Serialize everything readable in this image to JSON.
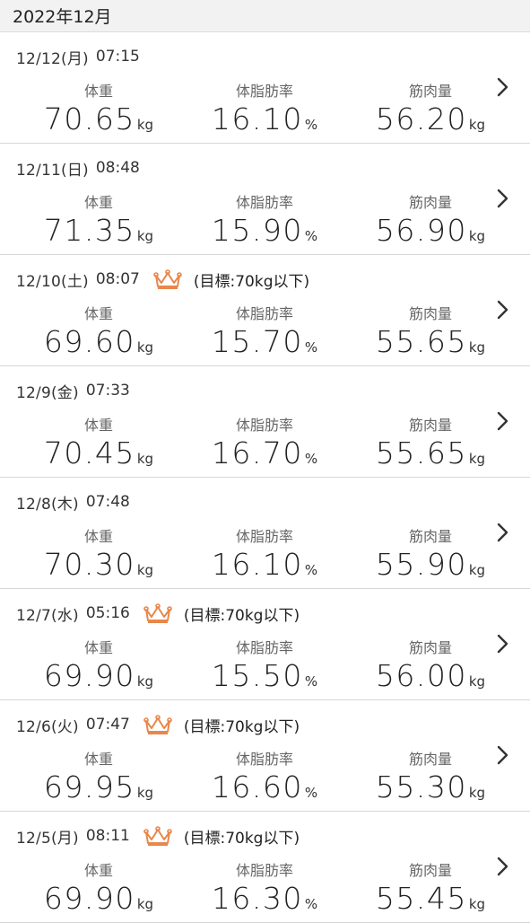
{
  "header": {
    "month": "2022年12月"
  },
  "labels": {
    "weight": "体重",
    "body_fat": "体脂肪率",
    "muscle": "筋肉量"
  },
  "units": {
    "kg": "kg",
    "percent": "%"
  },
  "goal_text": "(目標:70kg以下)",
  "colors": {
    "crown": "#e8874a",
    "divider": "#d6d6d6",
    "header_bg": "#f2f2f2"
  },
  "entries": [
    {
      "date": "12/12(月)",
      "time": "07:15",
      "goal_met": false,
      "weight": "70.65",
      "body_fat": "16.10",
      "muscle": "56.20"
    },
    {
      "date": "12/11(日)",
      "time": "08:48",
      "goal_met": false,
      "weight": "71.35",
      "body_fat": "15.90",
      "muscle": "56.90"
    },
    {
      "date": "12/10(土)",
      "time": "08:07",
      "goal_met": true,
      "weight": "69.60",
      "body_fat": "15.70",
      "muscle": "55.65"
    },
    {
      "date": "12/9(金)",
      "time": "07:33",
      "goal_met": false,
      "weight": "70.45",
      "body_fat": "16.70",
      "muscle": "55.65"
    },
    {
      "date": "12/8(木)",
      "time": "07:48",
      "goal_met": false,
      "weight": "70.30",
      "body_fat": "16.10",
      "muscle": "55.90"
    },
    {
      "date": "12/7(水)",
      "time": "05:16",
      "goal_met": true,
      "weight": "69.90",
      "body_fat": "15.50",
      "muscle": "56.00"
    },
    {
      "date": "12/6(火)",
      "time": "07:47",
      "goal_met": true,
      "weight": "69.95",
      "body_fat": "16.60",
      "muscle": "55.30"
    },
    {
      "date": "12/5(月)",
      "time": "08:11",
      "goal_met": true,
      "weight": "69.90",
      "body_fat": "16.30",
      "muscle": "55.45"
    }
  ]
}
